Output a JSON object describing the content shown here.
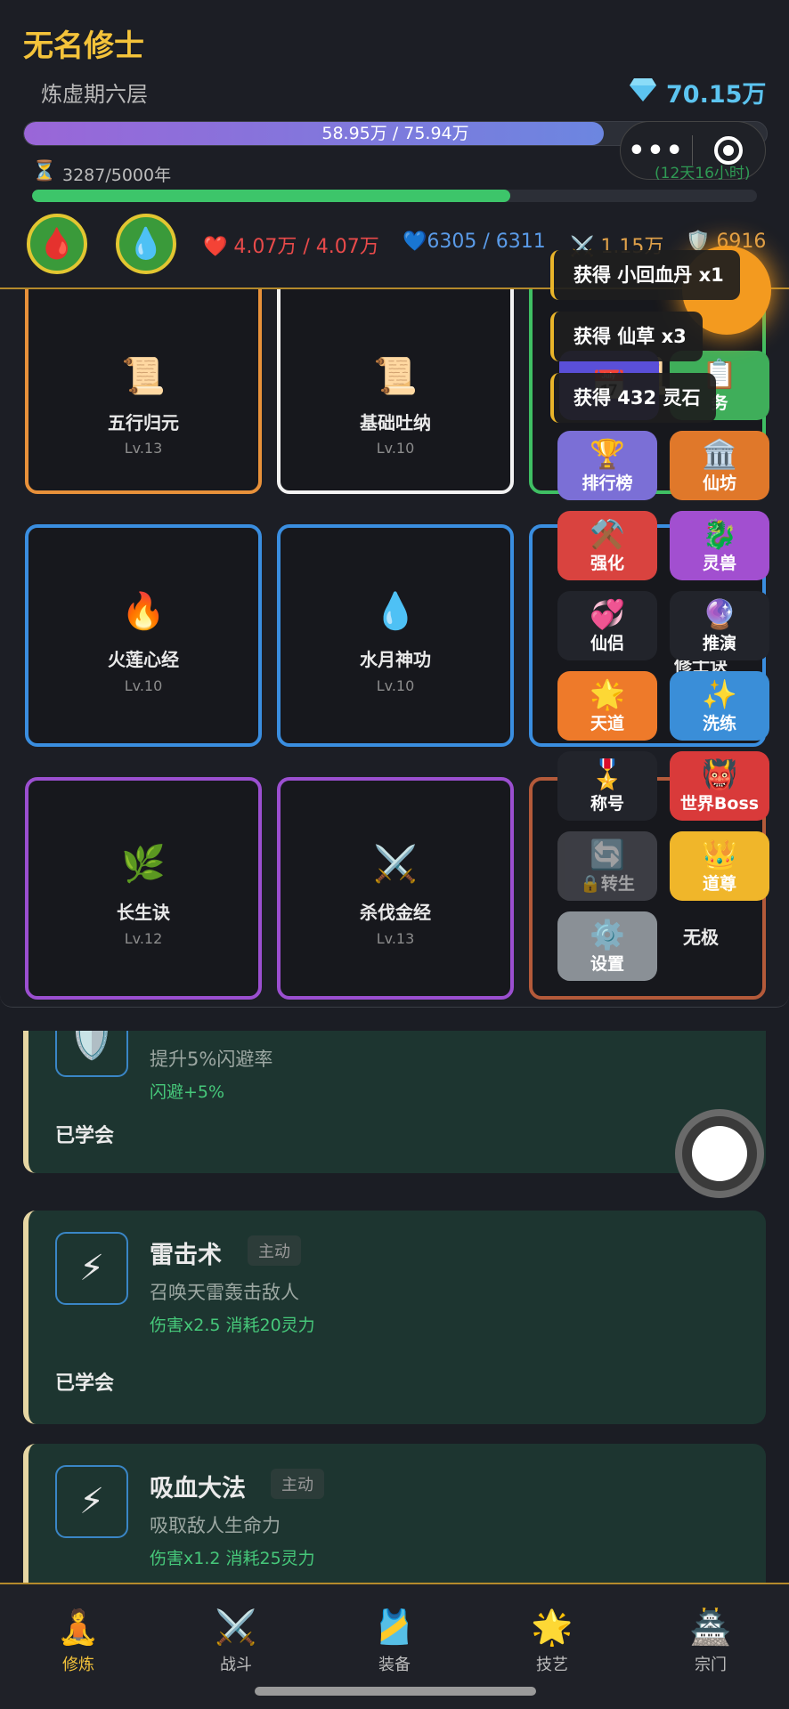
{
  "header": {
    "player_name": "无名修士",
    "realm": "炼虚期六层",
    "gems": "70.15万",
    "exp_text": "58.95万 / 75.94万",
    "exp_progress": 0.78,
    "lifespan": "3287/5000年",
    "lifespan_progress": 0.66,
    "countdown": "(12天16小时)",
    "hp": "4.07万 / 4.07万",
    "mp": "6305 / 6311",
    "attack": "1.15万",
    "defense": "6916",
    "hp_potion_icon": "🩸",
    "mp_potion_icon": "💧",
    "menu_dots": "•••"
  },
  "techniques": [
    {
      "icon": "📜",
      "name": "五行归元",
      "level": "Lv.13",
      "color": "#e8913a"
    },
    {
      "icon": "📜",
      "name": "基础吐纳",
      "level": "Lv.10",
      "color": "#f2f2f2"
    },
    {
      "icon": "📜",
      "name": "",
      "level": "",
      "color": "#3fbf63"
    },
    {
      "icon": "🔥",
      "name": "火莲心经",
      "level": "Lv.10",
      "color": "#3a8ee0"
    },
    {
      "icon": "💧",
      "name": "水月神功",
      "level": "Lv.10",
      "color": "#3a8ee0"
    },
    {
      "icon": "",
      "name": "修士诀",
      "level": "",
      "color": "#3a8ee0"
    },
    {
      "icon": "🌿",
      "name": "长生诀",
      "level": "Lv.12",
      "color": "#9b4fd0"
    },
    {
      "icon": "⚔️",
      "name": "杀伐金经",
      "level": "Lv.13",
      "color": "#9b4fd0"
    },
    {
      "icon": "",
      "name": "无极",
      "level": "",
      "color": "#b45a3a"
    }
  ],
  "checkmark": "✓",
  "toasts": [
    "获得 小回血丹 x1",
    "获得 仙草 x3",
    "获得 432 灵石"
  ],
  "features": [
    {
      "icon": "📅",
      "label": "",
      "color": "#5a4fd8"
    },
    {
      "icon": "📋",
      "label": "务",
      "color": "#3fae5a"
    },
    {
      "icon": "🏆",
      "label": "排行榜",
      "color": "#7b6fd6"
    },
    {
      "icon": "🏛️",
      "label": "仙坊",
      "color": "#e0782a"
    },
    {
      "icon": "⚒️",
      "label": "强化",
      "color": "#d9433f"
    },
    {
      "icon": "🐉",
      "label": "灵兽",
      "color": "#a24fd0"
    },
    {
      "icon": "💞",
      "label": "仙侣",
      "color": "#22242b"
    },
    {
      "icon": "🔮",
      "label": "推演",
      "color": "#22242b"
    },
    {
      "icon": "🌟",
      "label": "天道",
      "color": "#ee7a2a"
    },
    {
      "icon": "✨",
      "label": "洗练",
      "color": "#3a8ed8"
    },
    {
      "icon": "🎖️",
      "label": "称号",
      "color": "#22242b"
    },
    {
      "icon": "👹",
      "label": "世界Boss",
      "color": "#d93a3a"
    },
    {
      "icon": "🔄",
      "label": "转生",
      "color": "#55575e"
    },
    {
      "icon": "👑",
      "label": "道尊",
      "color": "#f0b62a"
    },
    {
      "icon": "⚙️",
      "label": "设置",
      "color": "#8a9096"
    }
  ],
  "skills": [
    {
      "icon": "🛡️",
      "name": "",
      "tag": "",
      "desc": "提升5%闪避率",
      "effect": "闪避+5%",
      "status": "已学会"
    },
    {
      "icon": "⚡",
      "name": "雷击术",
      "tag": "主动",
      "desc": "召唤天雷轰击敌人",
      "effect": "伤害x2.5 消耗20灵力",
      "status": "已学会"
    },
    {
      "icon": "⚡",
      "name": "吸血大法",
      "tag": "主动",
      "desc": "吸取敌人生命力",
      "effect": "伤害x1.2 消耗25灵力",
      "status": ""
    }
  ],
  "nav": [
    {
      "icon": "🧘",
      "label": "修炼",
      "active": true
    },
    {
      "icon": "⚔️",
      "label": "战斗",
      "active": false
    },
    {
      "icon": "🎽",
      "label": "装备",
      "active": false
    },
    {
      "icon": "🌟",
      "label": "技艺",
      "active": false
    },
    {
      "icon": "🏯",
      "label": "宗门",
      "active": false
    }
  ],
  "colors": {
    "accent": "#f4c33a",
    "nav_active": "#f4c33a",
    "hp": "#e84a4a",
    "mp": "#5a9be8"
  }
}
